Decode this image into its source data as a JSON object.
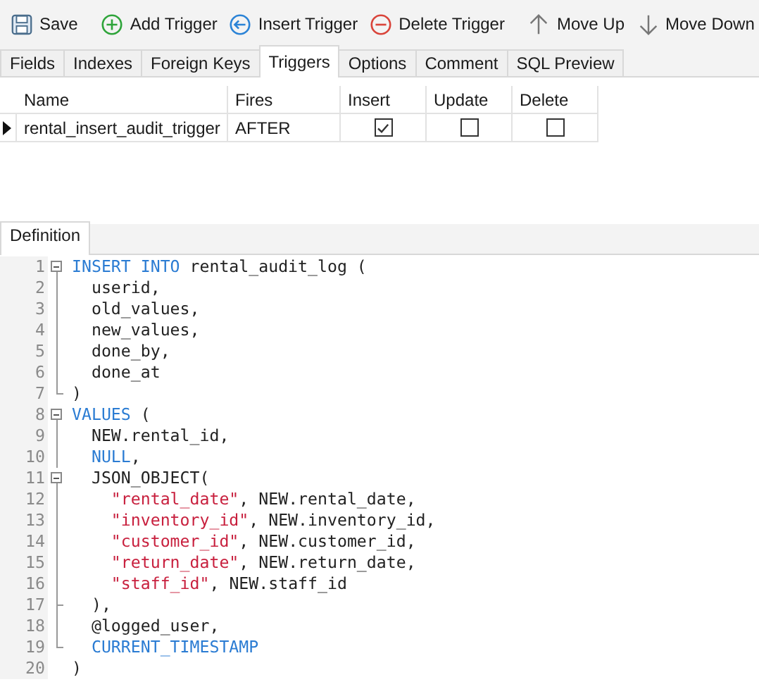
{
  "toolbar": [
    {
      "kind": "save",
      "label": "Save"
    },
    {
      "kind": "add",
      "label": "Add Trigger"
    },
    {
      "kind": "insert",
      "label": "Insert Trigger"
    },
    {
      "kind": "delete",
      "label": "Delete Trigger"
    },
    {
      "kind": "up",
      "label": "Move Up"
    },
    {
      "kind": "down",
      "label": "Move Down"
    }
  ],
  "tabs": [
    {
      "label": "Fields",
      "selected": false
    },
    {
      "label": "Indexes",
      "selected": false
    },
    {
      "label": "Foreign Keys",
      "selected": false
    },
    {
      "label": "Triggers",
      "selected": true
    },
    {
      "label": "Options",
      "selected": false
    },
    {
      "label": "Comment",
      "selected": false
    },
    {
      "label": "SQL Preview",
      "selected": false
    }
  ],
  "table": {
    "columns": [
      "Name",
      "Fires",
      "Insert",
      "Update",
      "Delete"
    ],
    "rows": [
      {
        "current": true,
        "name": "rental_insert_audit_trigger",
        "fires": "AFTER",
        "insert": true,
        "update": false,
        "delete": false
      }
    ]
  },
  "definition": {
    "tab": "Definition",
    "lines": [
      {
        "number": "1",
        "kind": "fold-start",
        "tokens": [
          {
            "kind": "keyword",
            "text": "INSERT INTO"
          },
          {
            "kind": "plain",
            "text": " rental_audit_log ("
          }
        ]
      },
      {
        "number": "2",
        "kind": "fold-line",
        "tokens": [
          {
            "kind": "plain",
            "text": "  userid,"
          }
        ]
      },
      {
        "number": "3",
        "kind": "fold-line",
        "tokens": [
          {
            "kind": "plain",
            "text": "  old_values,"
          }
        ]
      },
      {
        "number": "4",
        "kind": "fold-line",
        "tokens": [
          {
            "kind": "plain",
            "text": "  new_values,"
          }
        ]
      },
      {
        "number": "5",
        "kind": "fold-line",
        "tokens": [
          {
            "kind": "plain",
            "text": "  done_by,"
          }
        ]
      },
      {
        "number": "6",
        "kind": "fold-line",
        "tokens": [
          {
            "kind": "plain",
            "text": "  done_at"
          }
        ]
      },
      {
        "number": "7",
        "kind": "fold-end",
        "tokens": [
          {
            "kind": "plain",
            "text": ")"
          }
        ]
      },
      {
        "number": "8",
        "kind": "fold-start",
        "tokens": [
          {
            "kind": "keyword",
            "text": "VALUES"
          },
          {
            "kind": "plain",
            "text": " ("
          }
        ]
      },
      {
        "number": "9",
        "kind": "fold-line",
        "tokens": [
          {
            "kind": "plain",
            "text": "  NEW.rental_id,"
          }
        ]
      },
      {
        "number": "10",
        "kind": "fold-line",
        "tokens": [
          {
            "kind": "keyword",
            "text": "  NULL"
          },
          {
            "kind": "plain",
            "text": ","
          }
        ]
      },
      {
        "number": "11",
        "kind": "fold-start",
        "tokens": [
          {
            "kind": "plain",
            "text": "  JSON_OBJECT("
          }
        ]
      },
      {
        "number": "12",
        "kind": "fold-line",
        "tokens": [
          {
            "kind": "string",
            "text": "    \"rental_date\""
          },
          {
            "kind": "plain",
            "text": ", NEW.rental_date,"
          }
        ]
      },
      {
        "number": "13",
        "kind": "fold-line",
        "tokens": [
          {
            "kind": "string",
            "text": "    \"inventory_id\""
          },
          {
            "kind": "plain",
            "text": ", NEW.inventory_id,"
          }
        ]
      },
      {
        "number": "14",
        "kind": "fold-line",
        "tokens": [
          {
            "kind": "string",
            "text": "    \"customer_id\""
          },
          {
            "kind": "plain",
            "text": ", NEW.customer_id,"
          }
        ]
      },
      {
        "number": "15",
        "kind": "fold-line",
        "tokens": [
          {
            "kind": "string",
            "text": "    \"return_date\""
          },
          {
            "kind": "plain",
            "text": ", NEW.return_date,"
          }
        ]
      },
      {
        "number": "16",
        "kind": "fold-line",
        "tokens": [
          {
            "kind": "string",
            "text": "    \"staff_id\""
          },
          {
            "kind": "plain",
            "text": ", NEW.staff_id"
          }
        ]
      },
      {
        "number": "17",
        "kind": "fold-tee",
        "tokens": [
          {
            "kind": "plain",
            "text": "  ),"
          }
        ]
      },
      {
        "number": "18",
        "kind": "fold-line",
        "tokens": [
          {
            "kind": "plain",
            "text": "  @logged_user,"
          }
        ]
      },
      {
        "number": "19",
        "kind": "fold-end",
        "tokens": [
          {
            "kind": "keyword",
            "text": "  CURRENT_TIMESTAMP"
          }
        ]
      },
      {
        "number": "20",
        "kind": "plain",
        "tokens": [
          {
            "kind": "plain",
            "text": ")"
          }
        ]
      }
    ]
  }
}
